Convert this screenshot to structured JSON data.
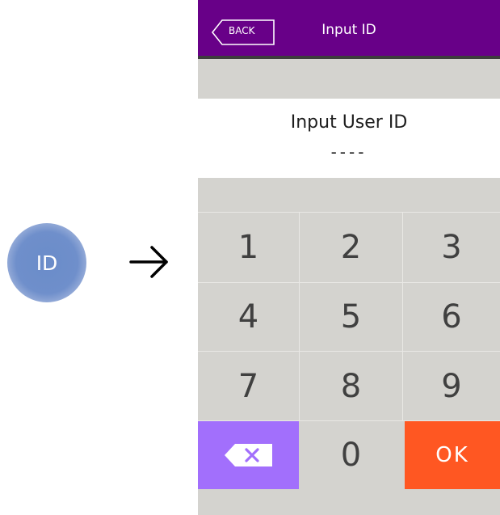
{
  "id_icon": {
    "label": "ID",
    "color": "#6f8fcb"
  },
  "arrow_icon": "right-arrow-icon",
  "header": {
    "back_label": "BACK",
    "title": "Input ID",
    "background": "#680088"
  },
  "prompt": {
    "label": "Input User ID",
    "value": "----"
  },
  "keypad": {
    "keys": [
      "1",
      "2",
      "3",
      "4",
      "5",
      "6",
      "7",
      "8",
      "9"
    ],
    "zero": "0",
    "ok": "OK",
    "backspace_icon": "backspace-icon",
    "backspace_color": "#a26ffc",
    "ok_color": "#ff5722"
  }
}
